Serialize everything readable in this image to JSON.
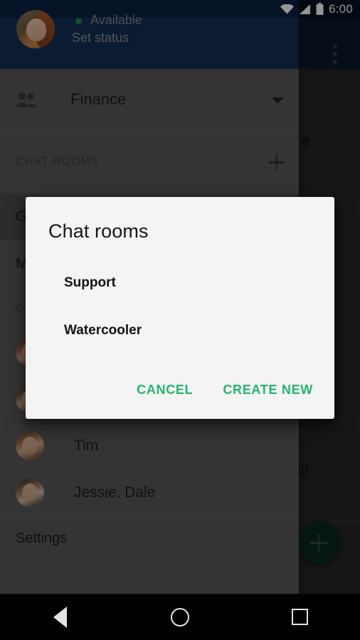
{
  "status_bar": {
    "time": "6:00",
    "icons": [
      "wifi-icon",
      "signal-icon",
      "battery-icon"
    ]
  },
  "background_app": {
    "overflow_menu": "overflow-menu-icon",
    "visible_text_fragments": [
      "e",
      "it!"
    ],
    "fab": {
      "icon": "plus-icon",
      "color": "#0a2a1c"
    }
  },
  "drawer": {
    "account": {
      "avatar": "user-avatar",
      "status": "Available",
      "status_color": "#1c8a4a",
      "set_status_label": "Set status"
    },
    "team": {
      "icon": "people-icon",
      "label": "Finance",
      "chevron": "chevron-down-icon"
    },
    "chat_rooms_section": {
      "label": "CHAT ROOMS",
      "add_icon": "plus-icon",
      "rooms": [
        {
          "label": "G",
          "selected": true
        },
        {
          "label": "M",
          "selected": false
        }
      ]
    },
    "direct_messages_section": {
      "label": "D",
      "items": [
        {
          "name": "",
          "avatar": "contact-avatar"
        },
        {
          "name": "",
          "avatar": "contact-avatar"
        },
        {
          "name": "Tim",
          "avatar": "contact-avatar"
        },
        {
          "name": "Jessie, Dale",
          "avatar": "contact-avatar"
        }
      ]
    },
    "settings_label": "Settings"
  },
  "dialog": {
    "title": "Chat rooms",
    "items": [
      "Support",
      "Watercooler"
    ],
    "cancel_label": "CANCEL",
    "create_label": "CREATE NEW",
    "accent_color": "#26b36e",
    "background": "#f4f4f4"
  },
  "nav_bar": {
    "back": "back-icon",
    "home": "home-icon",
    "recents": "recents-icon"
  }
}
